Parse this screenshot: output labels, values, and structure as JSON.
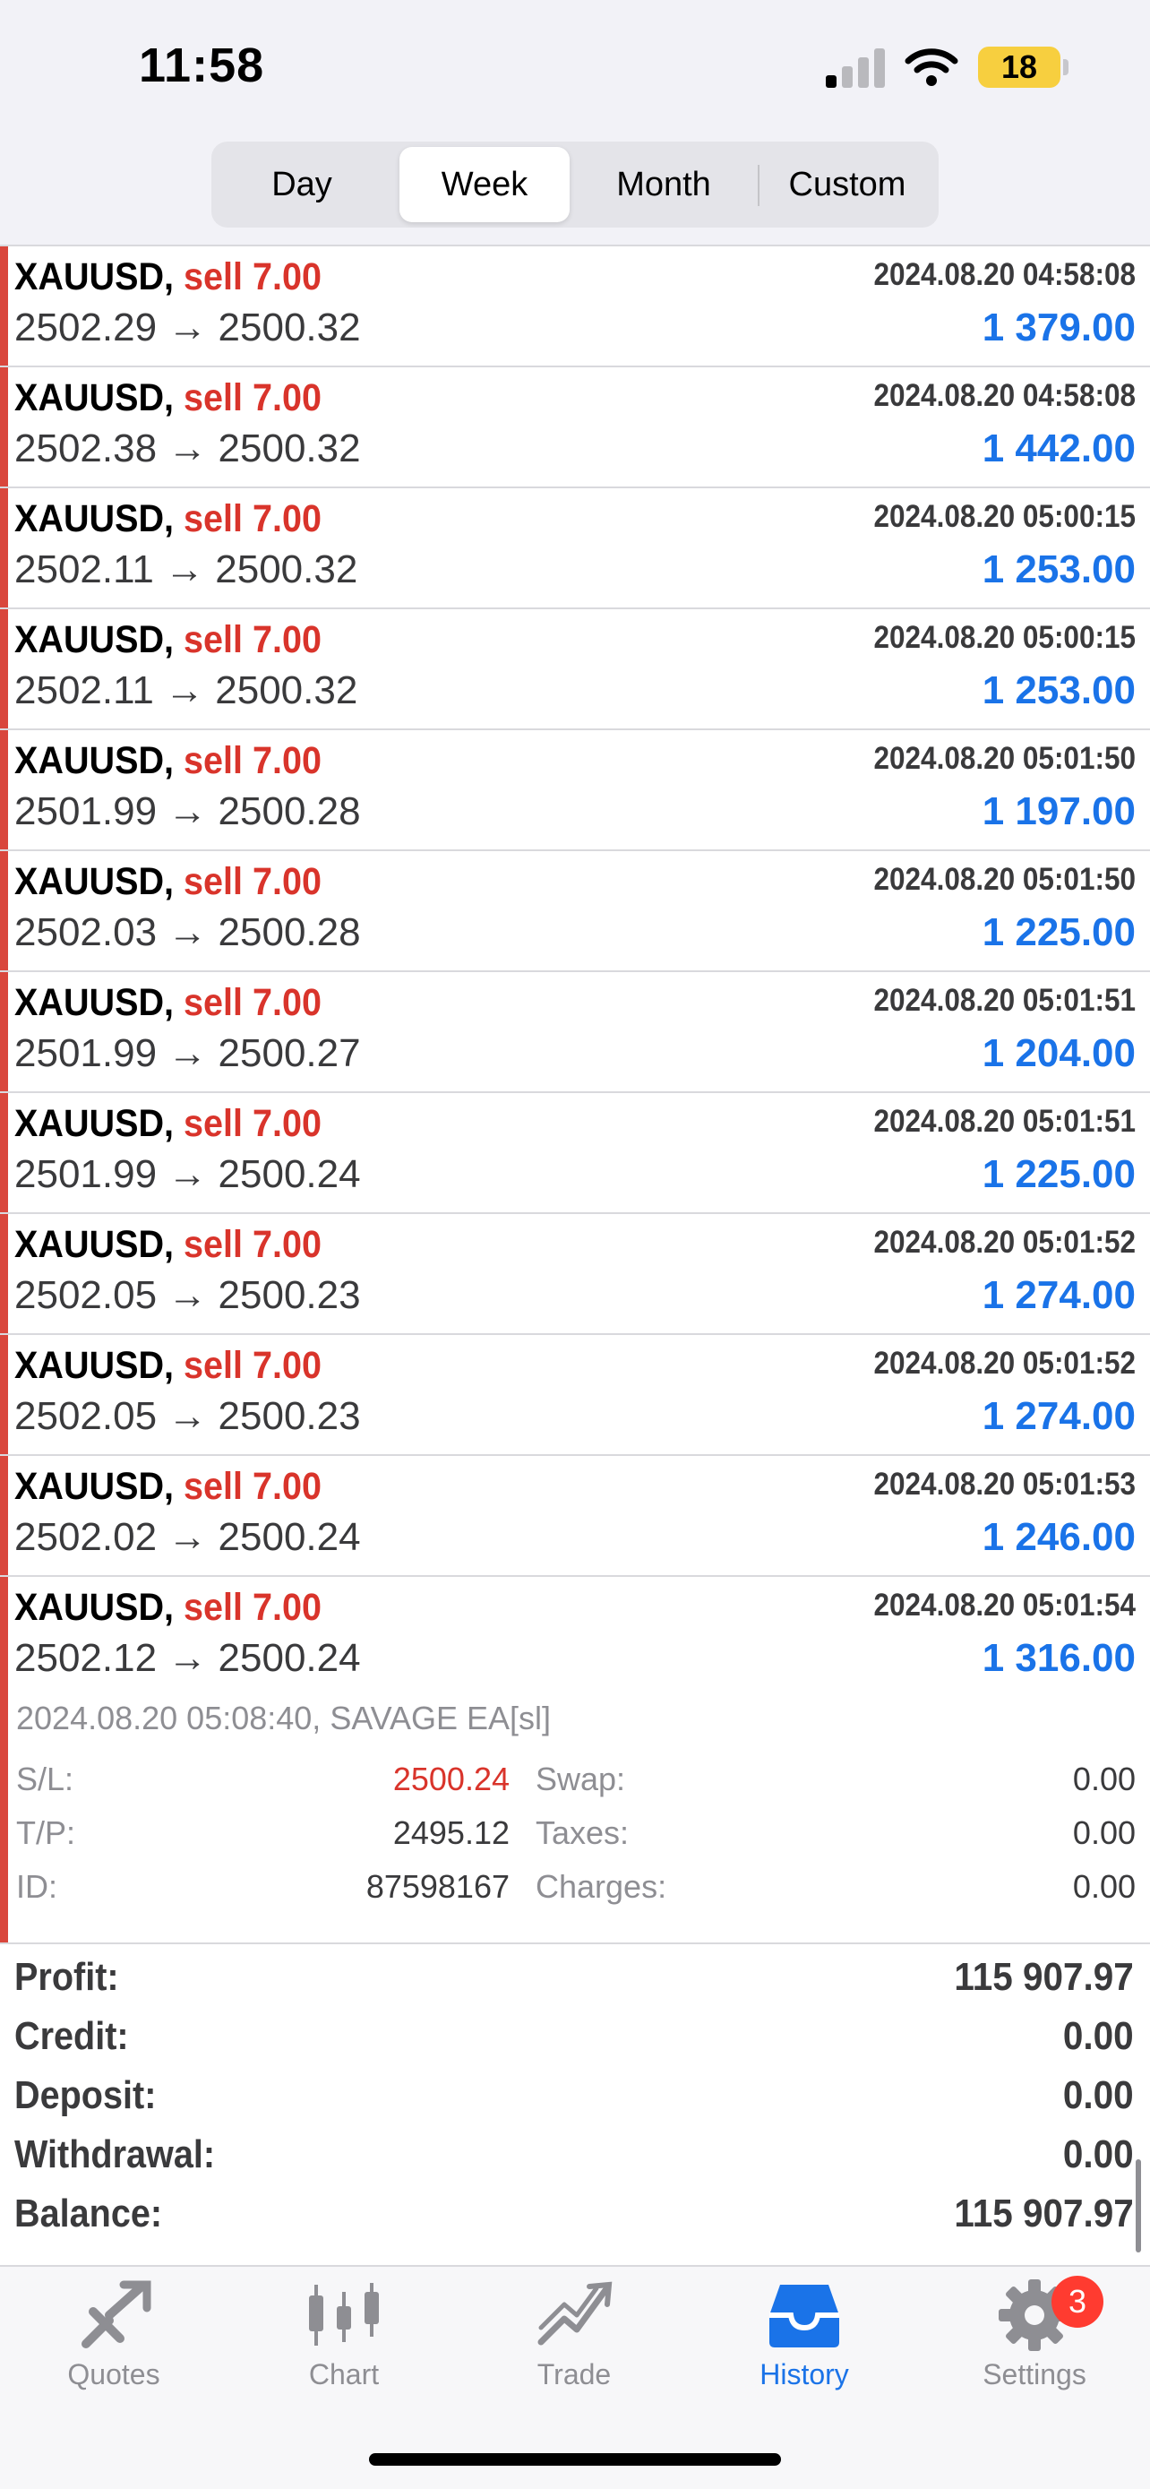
{
  "status": {
    "time": "11:58",
    "battery": "18"
  },
  "segments": [
    {
      "label": "Day",
      "active": false
    },
    {
      "label": "Week",
      "active": true
    },
    {
      "label": "Month",
      "active": false
    },
    {
      "label": "Custom",
      "active": false
    }
  ],
  "deals": [
    {
      "symbol": "XAUUSD,",
      "side": "sell 7.00",
      "open": "2502.29",
      "close": "2500.32",
      "date": "2024.08.20 04:58:08",
      "profit": "1 379.00"
    },
    {
      "symbol": "XAUUSD,",
      "side": "sell 7.00",
      "open": "2502.38",
      "close": "2500.32",
      "date": "2024.08.20 04:58:08",
      "profit": "1 442.00"
    },
    {
      "symbol": "XAUUSD,",
      "side": "sell 7.00",
      "open": "2502.11",
      "close": "2500.32",
      "date": "2024.08.20 05:00:15",
      "profit": "1 253.00"
    },
    {
      "symbol": "XAUUSD,",
      "side": "sell 7.00",
      "open": "2502.11",
      "close": "2500.32",
      "date": "2024.08.20 05:00:15",
      "profit": "1 253.00"
    },
    {
      "symbol": "XAUUSD,",
      "side": "sell 7.00",
      "open": "2501.99",
      "close": "2500.28",
      "date": "2024.08.20 05:01:50",
      "profit": "1 197.00"
    },
    {
      "symbol": "XAUUSD,",
      "side": "sell 7.00",
      "open": "2502.03",
      "close": "2500.28",
      "date": "2024.08.20 05:01:50",
      "profit": "1 225.00"
    },
    {
      "symbol": "XAUUSD,",
      "side": "sell 7.00",
      "open": "2501.99",
      "close": "2500.27",
      "date": "2024.08.20 05:01:51",
      "profit": "1 204.00"
    },
    {
      "symbol": "XAUUSD,",
      "side": "sell 7.00",
      "open": "2501.99",
      "close": "2500.24",
      "date": "2024.08.20 05:01:51",
      "profit": "1 225.00"
    },
    {
      "symbol": "XAUUSD,",
      "side": "sell 7.00",
      "open": "2502.05",
      "close": "2500.23",
      "date": "2024.08.20 05:01:52",
      "profit": "1 274.00"
    },
    {
      "symbol": "XAUUSD,",
      "side": "sell 7.00",
      "open": "2502.05",
      "close": "2500.23",
      "date": "2024.08.20 05:01:52",
      "profit": "1 274.00"
    },
    {
      "symbol": "XAUUSD,",
      "side": "sell 7.00",
      "open": "2502.02",
      "close": "2500.24",
      "date": "2024.08.20 05:01:53",
      "profit": "1 246.00"
    },
    {
      "symbol": "XAUUSD,",
      "side": "sell 7.00",
      "open": "2502.12",
      "close": "2500.24",
      "date": "2024.08.20 05:01:54",
      "profit": "1 316.00"
    }
  ],
  "arrow": "→",
  "details": {
    "comment": "2024.08.20 05:08:40, SAVAGE EA[sl]",
    "sl_label": "S/L:",
    "sl_value": "2500.24",
    "tp_label": "T/P:",
    "tp_value": "2495.12",
    "id_label": "ID:",
    "id_value": "87598167",
    "swap_label": "Swap:",
    "swap_value": "0.00",
    "taxes_label": "Taxes:",
    "taxes_value": "0.00",
    "charges_label": "Charges:",
    "charges_value": "0.00"
  },
  "summary": [
    {
      "label": "Profit:",
      "value": "115 907.97"
    },
    {
      "label": "Credit:",
      "value": "0.00"
    },
    {
      "label": "Deposit:",
      "value": "0.00"
    },
    {
      "label": "Withdrawal:",
      "value": "0.00"
    },
    {
      "label": "Balance:",
      "value": "115 907.97"
    }
  ],
  "tabs": [
    {
      "label": "Quotes",
      "icon": "quotes-icon"
    },
    {
      "label": "Chart",
      "icon": "candlestick-icon"
    },
    {
      "label": "Trade",
      "icon": "trade-icon"
    },
    {
      "label": "History",
      "icon": "inbox-icon"
    },
    {
      "label": "Settings",
      "icon": "gear-icon"
    }
  ],
  "settings_badge": "3",
  "colors": {
    "accent": "#1a73e8",
    "sell": "#d9342b",
    "muted": "#8e8e93"
  }
}
